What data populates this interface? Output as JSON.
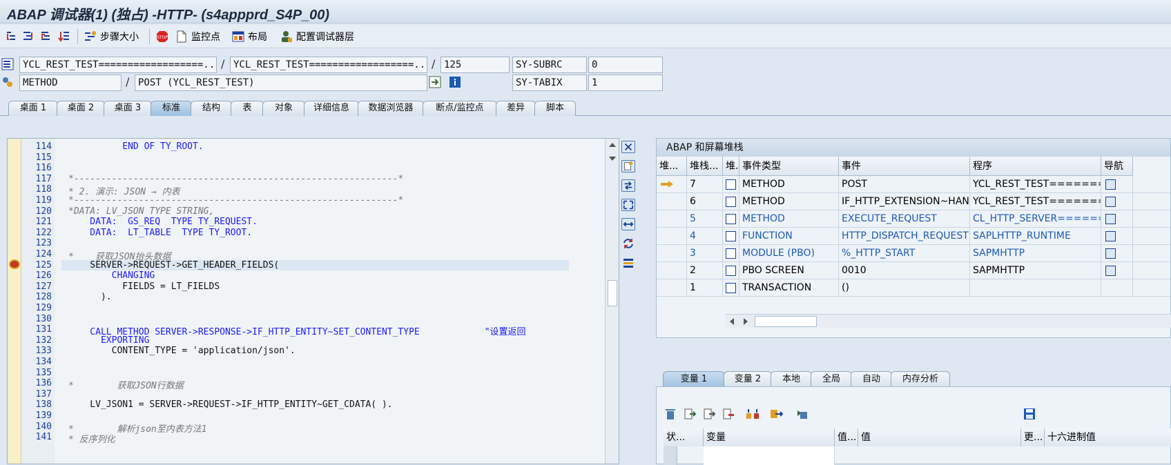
{
  "window": {
    "title": "ABAP 调试器(1)  (独占) -HTTP- (s4appprd_S4P_00)"
  },
  "toolbar": {
    "step_size": "步骤大小",
    "watchpoint": "监控点",
    "layout": "布局",
    "config": "配置调试器层"
  },
  "fields": {
    "program1": "YCL_REST_TEST==================...",
    "program2": "YCL_REST_TEST==================...",
    "line": "125",
    "sysvar1": "SY-SUBRC",
    "sysval1": "0",
    "event_type": "METHOD",
    "event": "POST (YCL_REST_TEST)",
    "sysvar2": "SY-TABIX",
    "sysval2": "1"
  },
  "tabs": [
    "桌面 1",
    "桌面 2",
    "桌面 3",
    "标准",
    "结构",
    "表",
    "对象",
    "详细信息",
    "数据浏览器",
    "断点/监控点",
    "差异",
    "脚本"
  ],
  "active_tab": "标准",
  "editor": {
    "lines": [
      {
        "n": "114",
        "t": "          END OF TY_ROOT."
      },
      {
        "n": "115",
        "t": ""
      },
      {
        "n": "116",
        "t": ""
      },
      {
        "n": "117",
        "t": "*------------------------------------------------------------*"
      },
      {
        "n": "118",
        "t": "* 2. 演示: JSON → 内表"
      },
      {
        "n": "119",
        "t": "*------------------------------------------------------------*"
      },
      {
        "n": "120",
        "t": "*DATA: LV_JSON TYPE STRING,"
      },
      {
        "n": "121",
        "t": "    DATA:  GS_REQ  TYPE TY_REQUEST."
      },
      {
        "n": "122",
        "t": "    DATA:  LT_TABLE  TYPE TY_ROOT."
      },
      {
        "n": "123",
        "t": ""
      },
      {
        "n": "124",
        "t": "*    获取JSON抬头数据"
      },
      {
        "n": "125",
        "t": "    SERVER->REQUEST->GET_HEADER_FIELDS("
      },
      {
        "n": "126",
        "t": "        CHANGING"
      },
      {
        "n": "127",
        "t": "          FIELDS = LT_FIELDS"
      },
      {
        "n": "128",
        "t": "      )."
      },
      {
        "n": "129",
        "t": ""
      },
      {
        "n": "130",
        "t": ""
      },
      {
        "n": "131",
        "t": "    CALL METHOD SERVER->RESPONSE->IF_HTTP_ENTITY~SET_CONTENT_TYPE            \"设置返回"
      },
      {
        "n": "132",
        "t": "      EXPORTING"
      },
      {
        "n": "133",
        "t": "        CONTENT_TYPE = 'application/json'."
      },
      {
        "n": "134",
        "t": ""
      },
      {
        "n": "135",
        "t": ""
      },
      {
        "n": "136",
        "t": "*        获取JSON行数据"
      },
      {
        "n": "137",
        "t": ""
      },
      {
        "n": "138",
        "t": "    LV_JSON1 = SERVER->REQUEST->IF_HTTP_ENTITY~GET_CDATA( )."
      },
      {
        "n": "139",
        "t": ""
      },
      {
        "n": "140",
        "t": "*        解析json至内表方法1"
      },
      {
        "n": "141",
        "t": "* 反序列化"
      }
    ]
  },
  "stack": {
    "title": "ABAP 和屏幕堆栈",
    "headers": [
      "堆...",
      "堆栈...",
      "堆...",
      "事件类型",
      "事件",
      "程序",
      "导航"
    ],
    "rows": [
      {
        "lvl": "7",
        "type": "METHOD",
        "event": "POST",
        "prog": "YCL_REST_TEST=======...",
        "blue": false
      },
      {
        "lvl": "6",
        "type": "METHOD",
        "event": "IF_HTTP_EXTENSION~HAND...",
        "prog": "YCL_REST_TEST=======...",
        "blue": false
      },
      {
        "lvl": "5",
        "type": "METHOD",
        "event": "EXECUTE_REQUEST",
        "prog": "CL_HTTP_SERVER=======...",
        "blue": true
      },
      {
        "lvl": "4",
        "type": "FUNCTION",
        "event": "HTTP_DISPATCH_REQUEST",
        "prog": "SAPLHTTP_RUNTIME",
        "blue": true
      },
      {
        "lvl": "3",
        "type": "MODULE (PBO)",
        "event": "%_HTTP_START",
        "prog": "SAPMHTTP",
        "blue": true
      },
      {
        "lvl": "2",
        "type": "PBO SCREEN",
        "event": "0010",
        "prog": "SAPMHTTP",
        "blue": false
      },
      {
        "lvl": "1",
        "type": "TRANSACTION",
        "event": "()",
        "prog": "",
        "blue": false
      }
    ]
  },
  "vartabs": [
    "变量 1",
    "变量 2",
    "本地",
    "全局",
    "自动",
    "内存分析"
  ],
  "active_vartab": "变量 1",
  "vartable": {
    "headers": [
      "状...",
      "变量",
      "值...",
      "值",
      "更...",
      "十六进制值"
    ]
  },
  "colors": {
    "accent": "#1a1aff",
    "comment": "#777777",
    "string": "#3b7a2a",
    "current_line": "#dbe7f3"
  }
}
